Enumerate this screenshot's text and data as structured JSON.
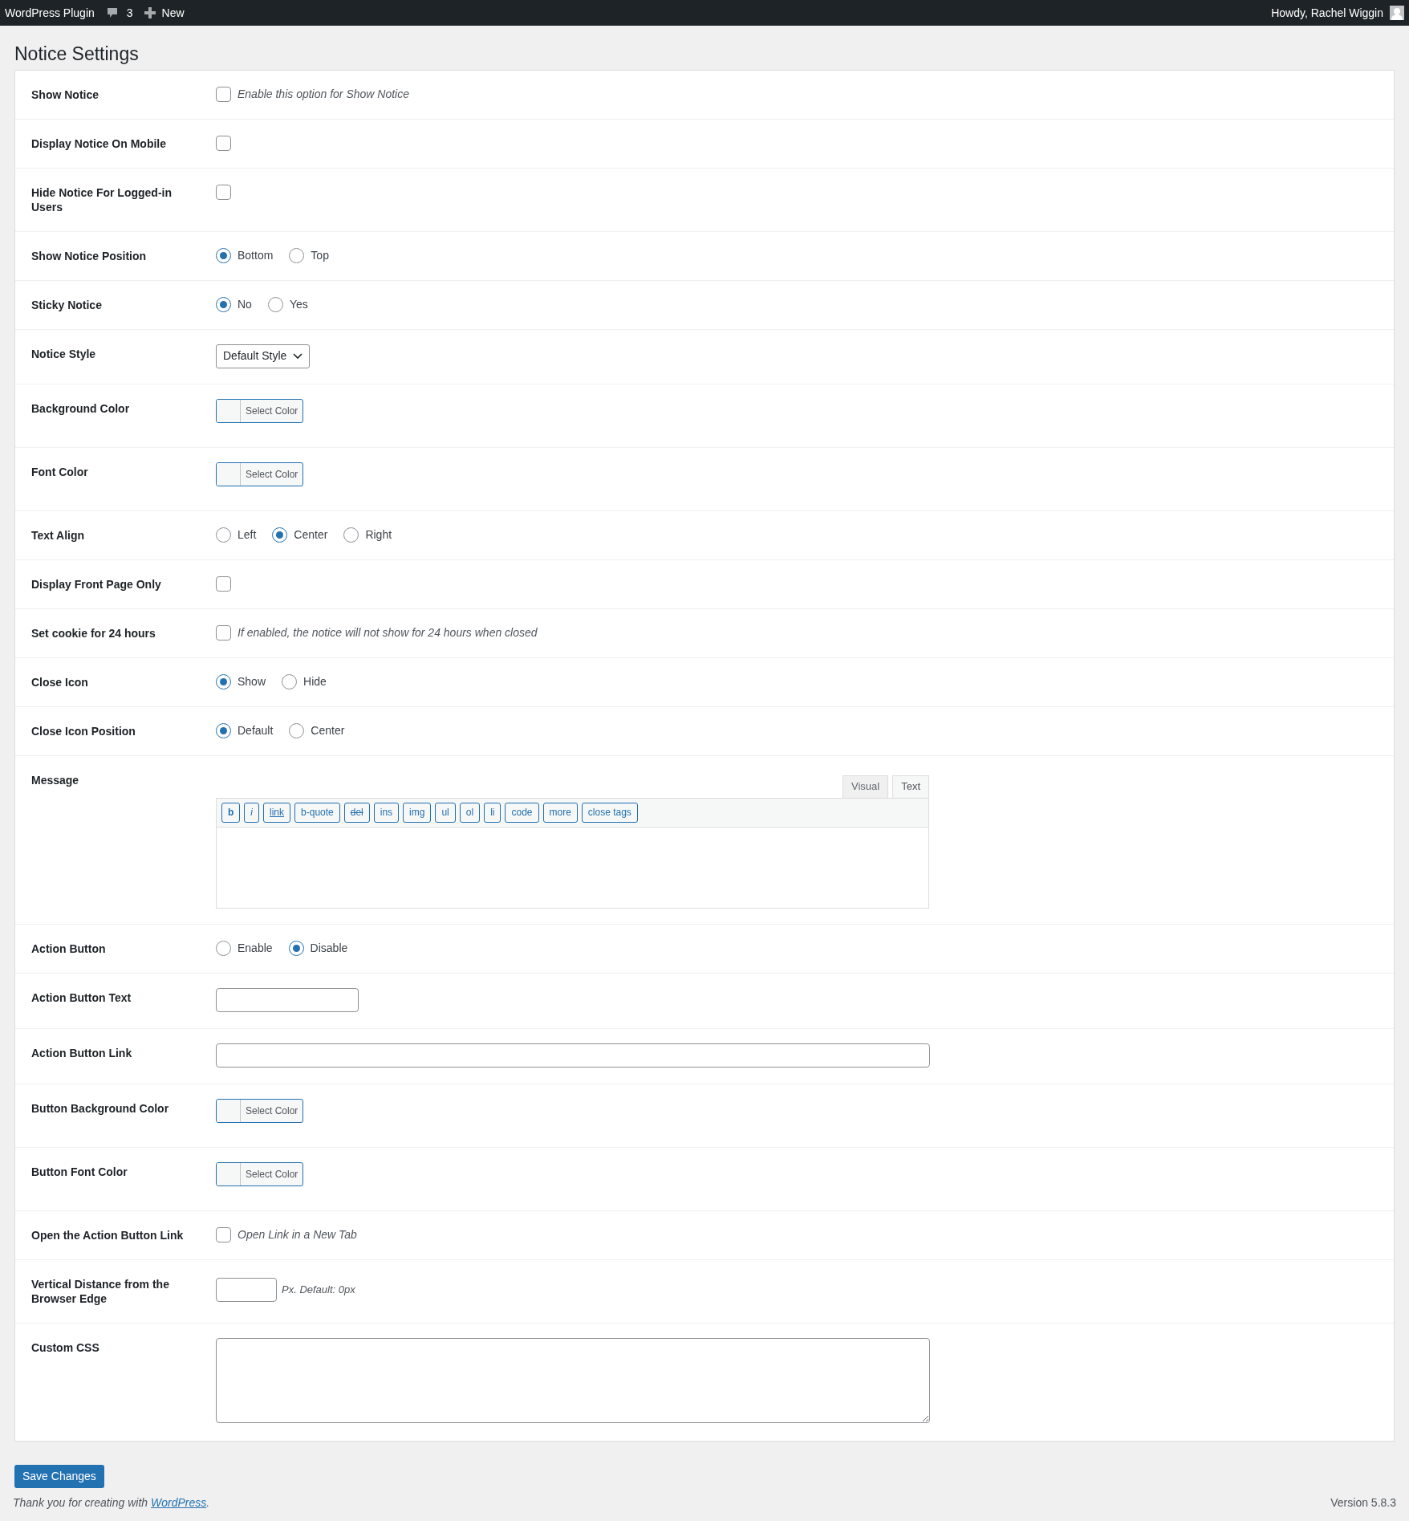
{
  "admin_bar": {
    "site": "WordPress Plugin",
    "comments": "3",
    "new": "New",
    "greeting": "Howdy, Rachel Wiggin"
  },
  "heading": "Notice Settings",
  "rows": [
    {
      "kind": "checkbox",
      "label": "Show Notice",
      "checked": false,
      "description": "Enable this option for Show Notice"
    },
    {
      "kind": "checkbox",
      "label": "Display Notice On Mobile",
      "checked": false
    },
    {
      "kind": "checkbox",
      "label": "Hide Notice For Logged-in Users",
      "checked": false
    },
    {
      "kind": "radio",
      "label": "Show Notice Position",
      "options": [
        {
          "label": "Bottom",
          "selected": true
        },
        {
          "label": "Top",
          "selected": false
        }
      ]
    },
    {
      "kind": "radio",
      "label": "Sticky Notice",
      "options": [
        {
          "label": "No",
          "selected": true
        },
        {
          "label": "Yes",
          "selected": false
        }
      ]
    },
    {
      "kind": "select",
      "label": "Notice Style",
      "value": "Default Style"
    },
    {
      "kind": "color",
      "label": "Background Color",
      "button": "Select Color"
    },
    {
      "kind": "color",
      "label": "Font Color",
      "button": "Select Color"
    },
    {
      "kind": "radio",
      "label": "Text Align",
      "options": [
        {
          "label": "Left",
          "selected": false
        },
        {
          "label": "Center",
          "selected": true
        },
        {
          "label": "Right",
          "selected": false
        }
      ]
    },
    {
      "kind": "checkbox",
      "label": "Display Front Page Only",
      "checked": false
    },
    {
      "kind": "checkbox",
      "label": "Set cookie for 24 hours",
      "checked": false,
      "description": "If enabled, the notice will not show for 24 hours when closed"
    },
    {
      "kind": "radio",
      "label": "Close Icon",
      "options": [
        {
          "label": "Show",
          "selected": true
        },
        {
          "label": "Hide",
          "selected": false
        }
      ]
    },
    {
      "kind": "radio",
      "label": "Close Icon Position",
      "options": [
        {
          "label": "Default",
          "selected": true
        },
        {
          "label": "Center",
          "selected": false
        }
      ]
    },
    {
      "kind": "editor",
      "label": "Message",
      "tabs": [
        {
          "label": "Visual",
          "selected": false
        },
        {
          "label": "Text",
          "selected": true
        }
      ],
      "buttons": [
        {
          "label": "b"
        },
        {
          "label": "i"
        },
        {
          "label": "link"
        },
        {
          "label": "b-quote"
        },
        {
          "label": "del"
        },
        {
          "label": "ins"
        },
        {
          "label": "img"
        },
        {
          "label": "ul"
        },
        {
          "label": "ol"
        },
        {
          "label": "li"
        },
        {
          "label": "code"
        },
        {
          "label": "more"
        },
        {
          "label": "close tags"
        }
      ]
    },
    {
      "kind": "radio",
      "label": "Action Button",
      "options": [
        {
          "label": "Enable",
          "selected": false
        },
        {
          "label": "Disable",
          "selected": true
        }
      ]
    },
    {
      "kind": "input",
      "label": "Action Button Text"
    },
    {
      "kind": "wide_input",
      "label": "Action Button Link"
    },
    {
      "kind": "color",
      "label": "Button Background Color",
      "button": "Select Color"
    },
    {
      "kind": "color",
      "label": "Button Font Color",
      "button": "Select Color"
    },
    {
      "kind": "checkbox",
      "label": "Open the Action Button Link",
      "checked": false,
      "description": "Open Link in a New Tab"
    },
    {
      "kind": "number",
      "label": "Vertical Distance from the Browser Edge",
      "suffix": "Px. Default: 0px"
    },
    {
      "kind": "textarea",
      "label": "Custom CSS"
    }
  ],
  "save_button": "Save Changes",
  "footer": {
    "text": "Thank you for creating with ",
    "link": "WordPress",
    "after": "."
  },
  "version": "Version 5.8.3"
}
